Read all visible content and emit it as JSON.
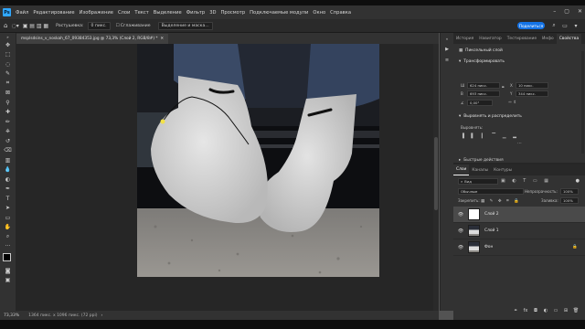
{
  "app": {
    "logo": "Ps"
  },
  "menu": [
    "Файл",
    "Редактирование",
    "Изображение",
    "Слои",
    "Текст",
    "Выделение",
    "Фильтр",
    "3D",
    "Просмотр",
    "Подключаемые модули",
    "Окно",
    "Справка"
  ],
  "options": {
    "feather_label": "Растушевка:",
    "feather_value": "0 пикс.",
    "antialias_label": "Сглаживание",
    "select_mask": "Выделение и маска...",
    "share": "Поделиться"
  },
  "document": {
    "tab_title": "msplsdsins_v_noskah_67_09384353.jpg @ 73,3% (Слой 2, RGB/8#) *",
    "zoom": "73,33%",
    "size_info": "1364 пикс. x 1096 пикс. (72 ppi)"
  },
  "panel_tabs_top": [
    "История",
    "Навигатор",
    "Тестирование",
    "Инфо",
    "Свойства"
  ],
  "properties": {
    "layer_kind": "Пиксельный слой",
    "transform_title": "Трансформировать",
    "w_label": "Ш",
    "w_value": "624 пикс.",
    "h_label": "В",
    "h_value": "693 пикс.",
    "x_label": "X",
    "x_value": "10 пикс.",
    "y_label": "Y",
    "y_value": "344 пикс.",
    "angle_value": "0,00°",
    "align_title": "Выровнять и распределить",
    "align_label": "Выровнять:",
    "quick_actions": "Быстрые действия"
  },
  "panel_tabs_bottom": [
    "Слои",
    "Каналы",
    "Контуры"
  ],
  "layers_panel": {
    "filter_label": "Вид",
    "blend_mode": "Обычные",
    "opacity_label": "Непрозрачность:",
    "opacity_value": "100%",
    "lock_label": "Закрепить:",
    "fill_label": "Заливка:",
    "fill_value": "100%",
    "layers": [
      {
        "name": "Слой 2",
        "selected": true
      },
      {
        "name": "Слой 1",
        "selected": false
      },
      {
        "name": "Фон",
        "selected": false
      }
    ]
  },
  "icons": {
    "eye": "eye-icon",
    "lock": "lock-icon",
    "search": "search-icon",
    "home": "home-icon"
  }
}
